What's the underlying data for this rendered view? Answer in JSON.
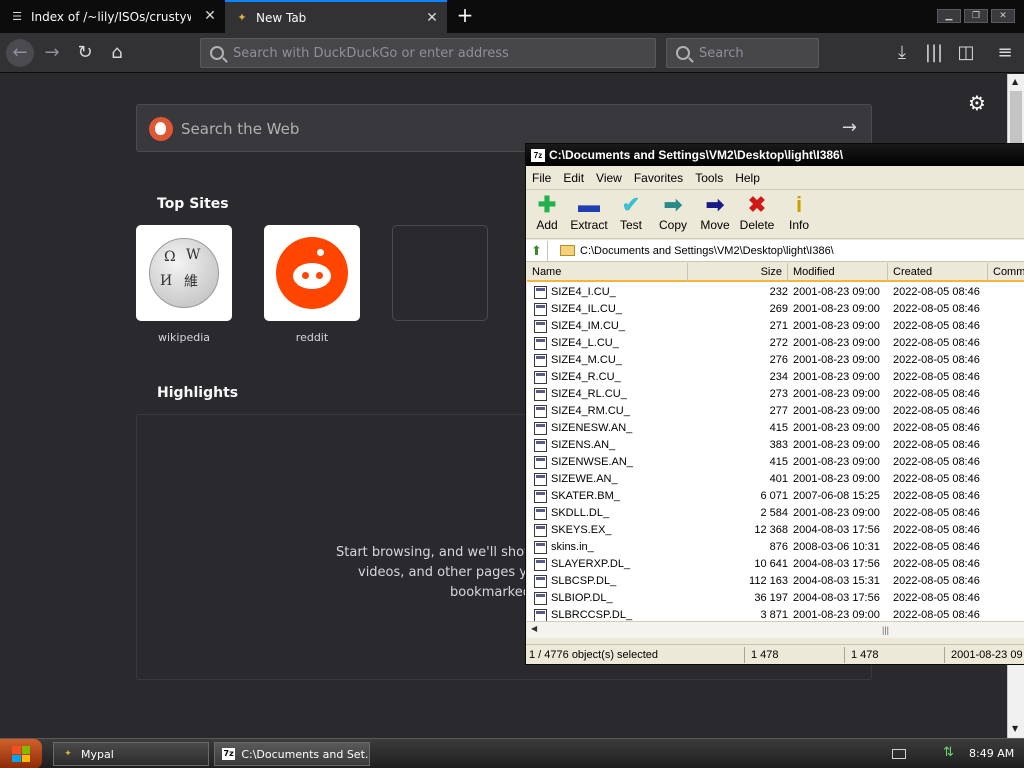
{
  "browser": {
    "tabs": [
      {
        "title": "Index of /~lily/ISOs/crustywindow",
        "active": false
      },
      {
        "title": "New Tab",
        "active": true
      }
    ],
    "window_controls": [
      "minimize",
      "restore",
      "close"
    ],
    "url_placeholder": "Search with DuckDuckGo or enter address",
    "search_placeholder": "Search"
  },
  "newtab": {
    "web_search_placeholder": "Search the Web",
    "top_sites_title": "Top Sites",
    "top_sites": [
      {
        "label": "wikipedia",
        "icon": "wikipedia-globe-icon"
      },
      {
        "label": "reddit",
        "icon": "reddit-alien-icon"
      },
      {
        "label": "",
        "icon": ""
      }
    ],
    "highlights_title": "Highlights",
    "highlights_text": [
      "Start browsing, and we'll show s",
      "videos, and other pages you",
      "bookmarked"
    ]
  },
  "zip": {
    "title": "C:\\Documents and Settings\\VM2\\Desktop\\light\\I386\\",
    "menu": [
      "File",
      "Edit",
      "View",
      "Favorites",
      "Tools",
      "Help"
    ],
    "toolbar": [
      {
        "label": "Add",
        "icon": "plus-icon",
        "color": "#22b14c"
      },
      {
        "label": "Extract",
        "icon": "minus-icon",
        "color": "#1f3fb0"
      },
      {
        "label": "Test",
        "icon": "check-icon",
        "color": "#3ac0d0"
      },
      {
        "label": "Copy",
        "icon": "copy-arrow-icon",
        "color": "#2a8a8a"
      },
      {
        "label": "Move",
        "icon": "move-arrow-icon",
        "color": "#1a1a8a"
      },
      {
        "label": "Delete",
        "icon": "delete-x-icon",
        "color": "#d01818"
      },
      {
        "label": "Info",
        "icon": "info-icon",
        "color": "#c8a000"
      }
    ],
    "path": "C:\\Documents and Settings\\VM2\\Desktop\\light\\I386\\",
    "columns": [
      "Name",
      "Size",
      "Modified",
      "Created",
      "Comm"
    ],
    "files": [
      {
        "name": "SIZE4_I.CU_",
        "size": "232",
        "modified": "2001-08-23 09:00",
        "created": "2022-08-05 08:46"
      },
      {
        "name": "SIZE4_IL.CU_",
        "size": "269",
        "modified": "2001-08-23 09:00",
        "created": "2022-08-05 08:46"
      },
      {
        "name": "SIZE4_IM.CU_",
        "size": "271",
        "modified": "2001-08-23 09:00",
        "created": "2022-08-05 08:46"
      },
      {
        "name": "SIZE4_L.CU_",
        "size": "272",
        "modified": "2001-08-23 09:00",
        "created": "2022-08-05 08:46"
      },
      {
        "name": "SIZE4_M.CU_",
        "size": "276",
        "modified": "2001-08-23 09:00",
        "created": "2022-08-05 08:46"
      },
      {
        "name": "SIZE4_R.CU_",
        "size": "234",
        "modified": "2001-08-23 09:00",
        "created": "2022-08-05 08:46"
      },
      {
        "name": "SIZE4_RL.CU_",
        "size": "273",
        "modified": "2001-08-23 09:00",
        "created": "2022-08-05 08:46"
      },
      {
        "name": "SIZE4_RM.CU_",
        "size": "277",
        "modified": "2001-08-23 09:00",
        "created": "2022-08-05 08:46"
      },
      {
        "name": "SIZENESW.AN_",
        "size": "415",
        "modified": "2001-08-23 09:00",
        "created": "2022-08-05 08:46"
      },
      {
        "name": "SIZENS.AN_",
        "size": "383",
        "modified": "2001-08-23 09:00",
        "created": "2022-08-05 08:46"
      },
      {
        "name": "SIZENWSE.AN_",
        "size": "415",
        "modified": "2001-08-23 09:00",
        "created": "2022-08-05 08:46"
      },
      {
        "name": "SIZEWE.AN_",
        "size": "401",
        "modified": "2001-08-23 09:00",
        "created": "2022-08-05 08:46"
      },
      {
        "name": "SKATER.BM_",
        "size": "6 071",
        "modified": "2007-06-08 15:25",
        "created": "2022-08-05 08:46"
      },
      {
        "name": "SKDLL.DL_",
        "size": "2 584",
        "modified": "2001-08-23 09:00",
        "created": "2022-08-05 08:46"
      },
      {
        "name": "SKEYS.EX_",
        "size": "12 368",
        "modified": "2004-08-03 17:56",
        "created": "2022-08-05 08:46"
      },
      {
        "name": "skins.in_",
        "size": "876",
        "modified": "2008-03-06 10:31",
        "created": "2022-08-05 08:46"
      },
      {
        "name": "SLAYERXP.DL_",
        "size": "10 641",
        "modified": "2004-08-03 17:56",
        "created": "2022-08-05 08:46"
      },
      {
        "name": "SLBCSP.DL_",
        "size": "112 163",
        "modified": "2004-08-03 15:31",
        "created": "2022-08-05 08:46"
      },
      {
        "name": "SLBIOP.DL_",
        "size": "36 197",
        "modified": "2004-08-03 17:56",
        "created": "2022-08-05 08:46"
      },
      {
        "name": "SLBRCCSP.DL_",
        "size": "3 871",
        "modified": "2001-08-23 09:00",
        "created": "2022-08-05 08:46"
      }
    ],
    "status": {
      "selection": "1 / 4776 object(s) selected",
      "size": "1 478",
      "packed": "1 478",
      "date": "2001-08-23 09"
    }
  },
  "taskbar": {
    "items": [
      {
        "label": "Mypal",
        "icon": "mypal-icon"
      },
      {
        "label": "C:\\Documents and Set...",
        "icon": "7zip-icon"
      }
    ],
    "clock": "8:49 AM"
  }
}
